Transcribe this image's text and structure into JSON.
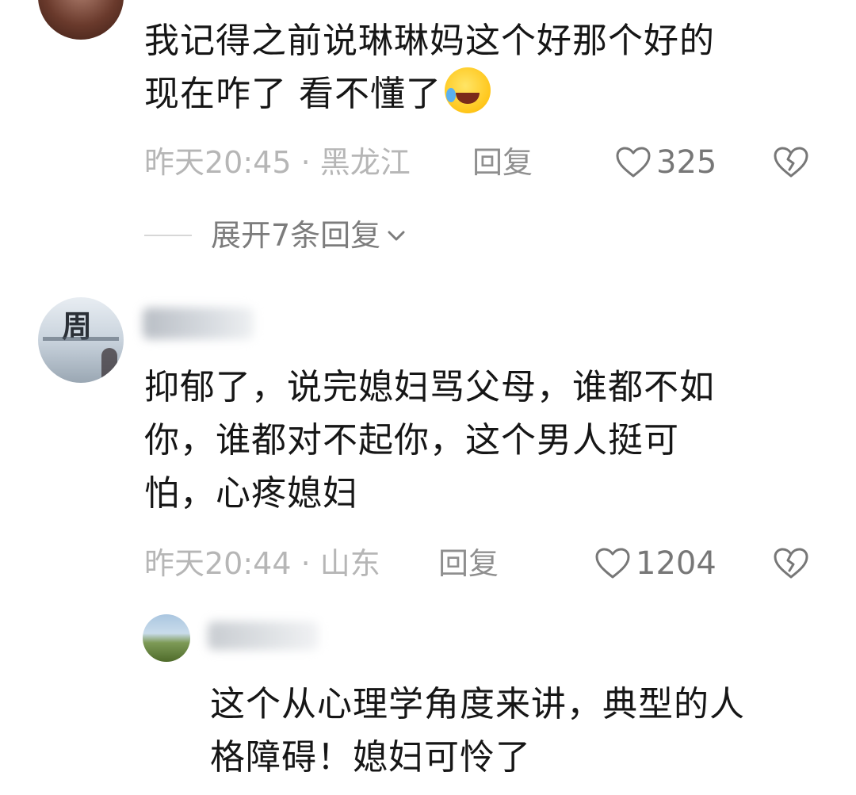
{
  "comments": [
    {
      "text_line1": "我记得之前说琳琳妈这个好那个好的",
      "text_line2": "现在咋了 看不懂了",
      "emoji_icon": "laughing-crying-emoji-icon",
      "time": "昨天20:45",
      "separator": "·",
      "location": "黑龙江",
      "reply_label": "回复",
      "likes": "325",
      "expand_label": "展开7条回复"
    },
    {
      "text_line1": "抑郁了，说完媳妇骂父母，谁都不如",
      "text_line2": "你，谁都对不起你，这个男人挺可",
      "text_line3": "怕，心疼媳妇",
      "avatar_glyph": "周",
      "time": "昨天20:44",
      "separator": "·",
      "location": "山东",
      "reply_label": "回复",
      "likes": "1204"
    },
    {
      "text_line1": "这个从心理学角度来讲，典型的人",
      "text_line2": "格障碍！媳妇可怜了"
    }
  ],
  "colors": {
    "meta_gray": "#b6b6b6",
    "reply_gray": "#8f8f8f",
    "icon_gray": "#777777",
    "body_text": "#161616"
  }
}
